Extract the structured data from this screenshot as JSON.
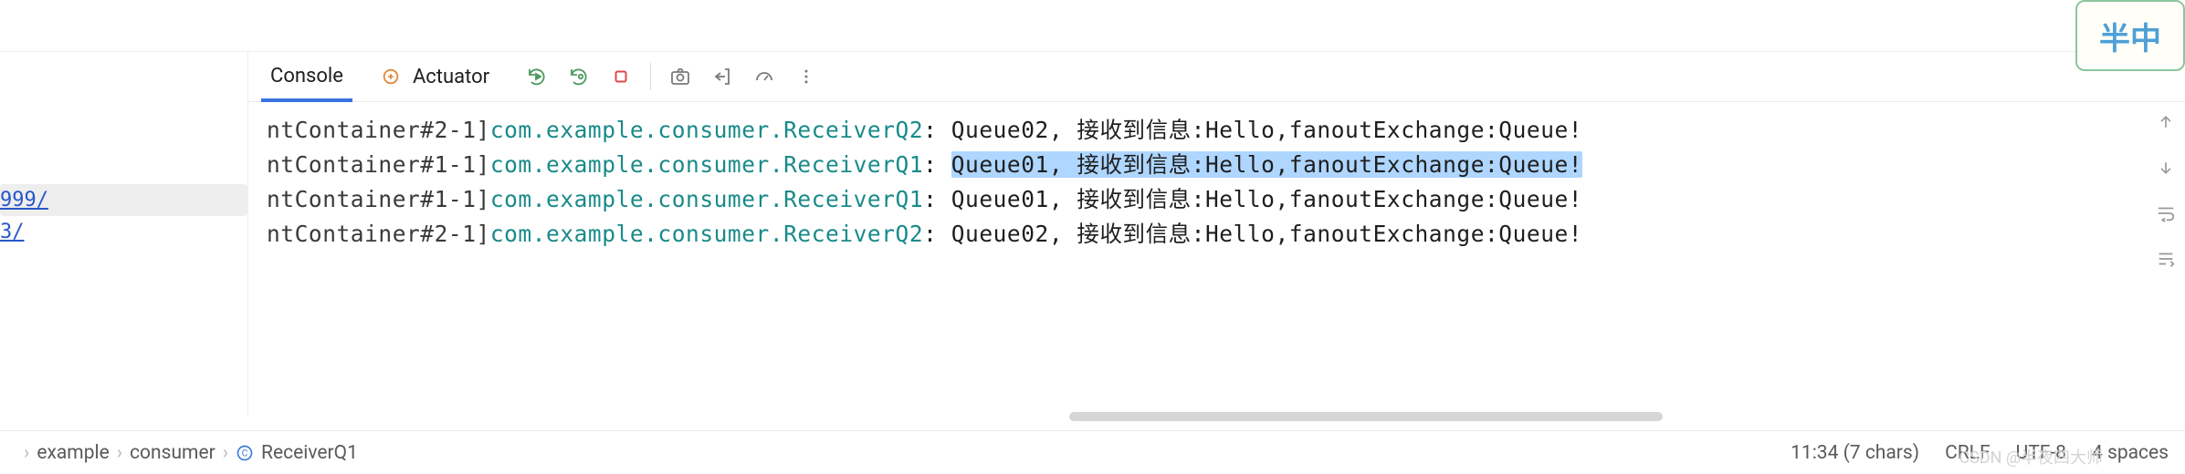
{
  "decor": {
    "text": "半中"
  },
  "sidebar": {
    "links": [
      {
        "label": "999/",
        "selected": true
      },
      {
        "label": "3/",
        "selected": false
      }
    ]
  },
  "tabs": {
    "console_label": "Console",
    "actuator_label": "Actuator"
  },
  "console": {
    "lines": [
      {
        "thread": "ntContainer#2-1]",
        "class": "com.example.consumer.ReceiverQ2",
        "msg_prefix": ": ",
        "msg_body": "Queue02, 接收到信息:Hello,fanoutExchange:Queue!",
        "highlighted": false
      },
      {
        "thread": "ntContainer#1-1]",
        "class": "com.example.consumer.ReceiverQ1",
        "msg_prefix": ": ",
        "msg_body": "Queue01, 接收到信息:Hello,fanoutExchange:Queue!",
        "highlighted": true
      },
      {
        "thread": "ntContainer#1-1]",
        "class": "com.example.consumer.ReceiverQ1",
        "msg_prefix": ": ",
        "msg_body": "Queue01, 接收到信息:Hello,fanoutExchange:Queue!",
        "highlighted": false
      },
      {
        "thread": "ntContainer#2-1]",
        "class": "com.example.consumer.ReceiverQ2",
        "msg_prefix": ": ",
        "msg_body": "Queue02, 接收到信息:Hello,fanoutExchange:Queue!",
        "highlighted": false
      }
    ]
  },
  "breadcrumb": {
    "items": [
      "example",
      "consumer",
      "ReceiverQ1"
    ]
  },
  "status": {
    "cursor": "11:34 (7 chars)",
    "line_sep": "CRLF",
    "encoding": "UTF-8",
    "indent": "4 spaces"
  },
  "watermark": "CSDN @半夜四大师"
}
